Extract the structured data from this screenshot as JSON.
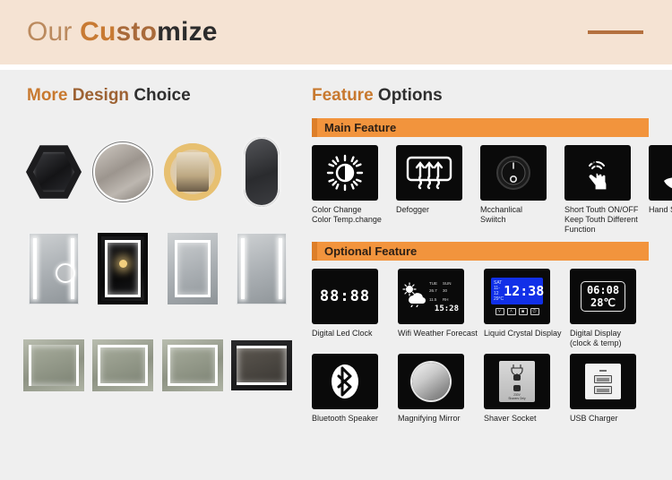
{
  "header": {
    "title_part1": "Our ",
    "title_part2": "Cu",
    "title_part3": "sto",
    "title_part4": "mize",
    "rule_color": "#b4713f",
    "background": "#f5e3d3"
  },
  "left_panel": {
    "heading_part1": "More ",
    "heading_part2": "Design",
    "heading_part3": " Choice",
    "mirror_rows": [
      [
        {
          "name": "hexagon-framed-mirror",
          "shape": "hexagon"
        },
        {
          "name": "round-backlit-mirror",
          "shape": "round"
        },
        {
          "name": "round-led-ring-mirror",
          "shape": "ring"
        },
        {
          "name": "oval-capsule-mirror",
          "shape": "oval"
        }
      ],
      [
        {
          "name": "vertical-mirror-with-magnifier",
          "shape": "vrect-magnifier"
        },
        {
          "name": "black-framed-vertical-mirror",
          "shape": "vrect-framed"
        },
        {
          "name": "vertical-led-border-mirror",
          "shape": "vrect-border"
        },
        {
          "name": "vertical-twin-strip-mirror",
          "shape": "vrect-strips"
        }
      ],
      [
        {
          "name": "landscape-side-led-mirror",
          "shape": "hrect-edge"
        },
        {
          "name": "landscape-border-led-mirror",
          "shape": "hrect-border"
        },
        {
          "name": "landscape-full-border-mirror",
          "shape": "hrect-border2"
        },
        {
          "name": "wide-landscape-led-mirror",
          "shape": "hrect-wide"
        }
      ]
    ]
  },
  "right_panel": {
    "heading_part1": "Feature",
    "heading_part2": " Options",
    "main_feature": {
      "band_label": "Main Feature",
      "band_color": "#f2943d",
      "band_accent": "#dd7f2a",
      "items": [
        {
          "icon": "sun-brightness-icon",
          "label": "Color Change\nColor Temp.change"
        },
        {
          "icon": "defogger-arrows-icon",
          "label": "Defogger"
        },
        {
          "icon": "rotary-knob-switch-icon",
          "label": "Mcchanlical\nSwiitch"
        },
        {
          "icon": "touch-hand-icon",
          "label": "Short Touth ON/OFF\nKeep Touth Different\nFunction"
        },
        {
          "icon": "hand-scan-sensor-icon",
          "label": "Hand Scan Sensor"
        }
      ]
    },
    "optional_feature": {
      "band_label": "Optional Feature",
      "items_row1": [
        {
          "icon": "digital-led-clock-icon",
          "label": "Digital Led Clock",
          "display": "88:88"
        },
        {
          "icon": "wifi-weather-forecast-icon",
          "label": "Wifi Weather Forecast",
          "display": "15:28"
        },
        {
          "icon": "liquid-crystal-display-icon",
          "label": "Liquid Crystal Display",
          "display": "12:38",
          "lcd_date": "11-12",
          "lcd_temp": "29°C",
          "lcd_day": "SAT",
          "lcd_color": "#1130e8"
        },
        {
          "icon": "digital-display-icon",
          "label": "Digital Display\n(clock & temp)",
          "display_time": "06:08",
          "display_temp": "28℃"
        }
      ],
      "items_row2": [
        {
          "icon": "bluetooth-speaker-icon",
          "label": "Bluetooth Speaker"
        },
        {
          "icon": "magnifying-mirror-icon",
          "label": "Magnifying Mirror"
        },
        {
          "icon": "shaver-socket-icon",
          "label": "Shaver Socket",
          "socket_text": "230V\nShavers Only"
        },
        {
          "icon": "usb-charger-icon",
          "label": "USB Charger"
        }
      ]
    }
  }
}
